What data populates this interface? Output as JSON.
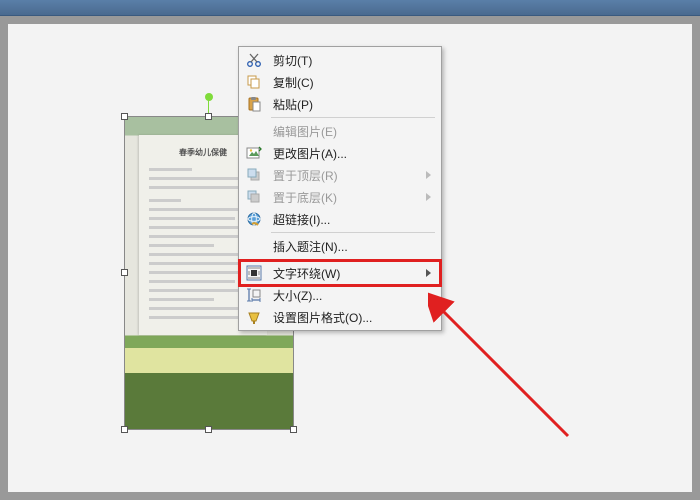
{
  "menu": {
    "cut": "剪切(T)",
    "copy": "复制(C)",
    "paste": "粘贴(P)",
    "edit_picture": "编辑图片(E)",
    "change_picture": "更改图片(A)...",
    "bring_to_front": "置于顶层(R)",
    "send_to_back": "置于底层(K)",
    "hyperlink": "超链接(I)...",
    "insert_caption": "插入题注(N)...",
    "text_wrapping": "文字环绕(W)",
    "size": "大小(Z)...",
    "format_picture": "设置图片格式(O)..."
  },
  "doc": {
    "title": "春季幼儿保健"
  },
  "annotation": {
    "highlight_color": "#e02020"
  }
}
